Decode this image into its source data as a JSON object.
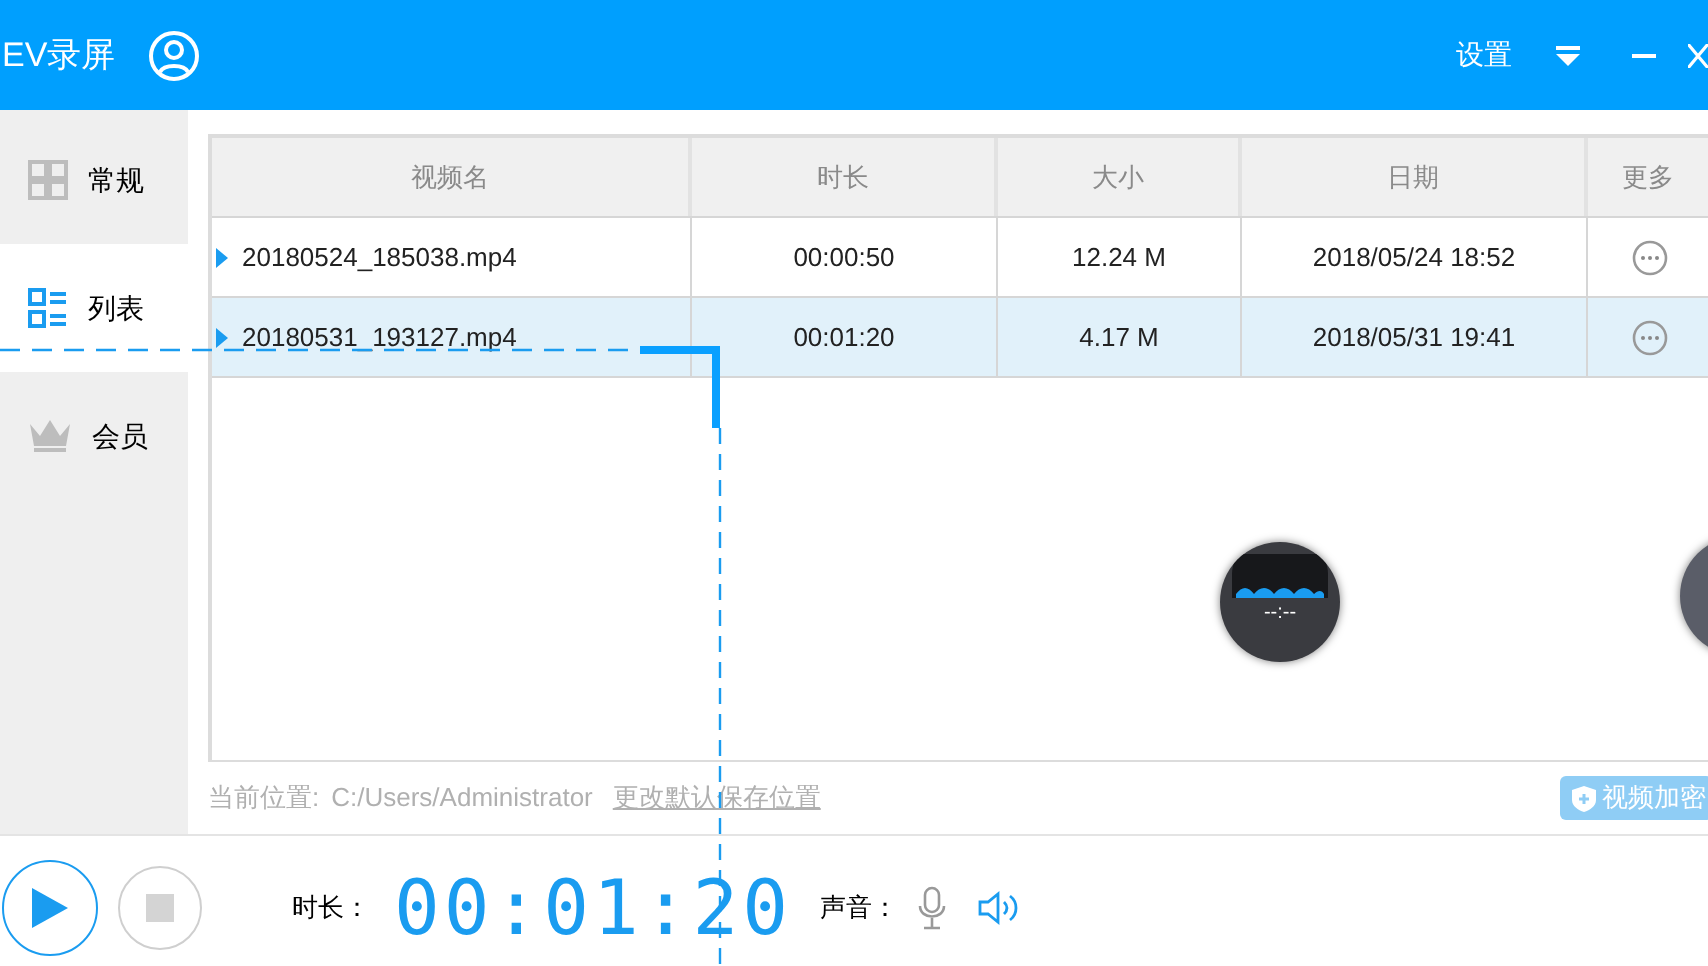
{
  "window": {
    "title": "EV录屏",
    "settings": "设置"
  },
  "sidebar": {
    "items": [
      {
        "label": "常规",
        "selected": false
      },
      {
        "label": "列表",
        "selected": true
      },
      {
        "label": "会员",
        "selected": false
      }
    ]
  },
  "table": {
    "columns": [
      "视频名",
      "时长",
      "大小",
      "日期",
      "更多"
    ],
    "rows": [
      {
        "name": "20180524_185038.mp4",
        "duration": "00:00:50",
        "size": "12.24 M",
        "date": "2018/05/24 18:52",
        "selected": false
      },
      {
        "name": "20180531_193127.mp4",
        "duration": "00:01:20",
        "size": "4.17 M",
        "date": "2018/05/31 19:41",
        "selected": true
      }
    ]
  },
  "location": {
    "label": "当前位置:",
    "path": "C:/Users/Administrator",
    "link": "更改默认保存位置"
  },
  "encrypt_button": "视频加密",
  "floating_widget": {
    "time": "--:--"
  },
  "player": {
    "duration_label": "时长：",
    "timer": "00:01:20",
    "sound_label": "声音："
  }
}
